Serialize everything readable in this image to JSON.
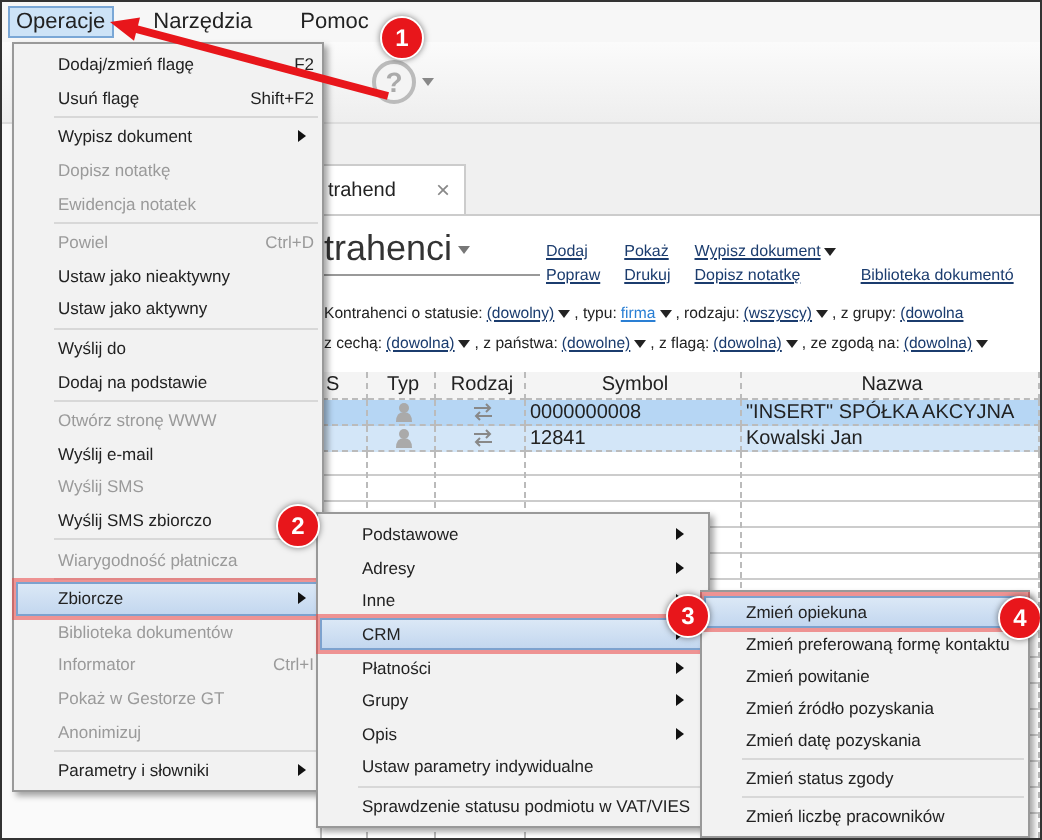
{
  "menubar": [
    {
      "label": "Operacje",
      "selected": true
    },
    {
      "label": "Narzędzia",
      "selected": false
    },
    {
      "label": "Pomoc",
      "selected": false
    }
  ],
  "toolbar": {
    "help_glyph": "?"
  },
  "tab": {
    "label": "trahend",
    "close": "×"
  },
  "heading": "trahenci",
  "link_columns": [
    [
      {
        "text": "Dodaj",
        "dropdown": false
      },
      {
        "text": "Popraw",
        "dropdown": false
      }
    ],
    [
      {
        "text": "Pokaż",
        "dropdown": false
      },
      {
        "text": "Drukuj",
        "dropdown": false
      }
    ],
    [
      {
        "text": "Wypisz dokument",
        "dropdown": true
      },
      {
        "text": "Dopisz notatkę",
        "dropdown": false
      }
    ],
    [
      {
        "text": "Biblioteka dokumentó",
        "dropdown": false
      }
    ]
  ],
  "filters": [
    [
      {
        "kind": "label",
        "text": "Kontrahenci o statusie:"
      },
      {
        "kind": "dropdown",
        "text": "(dowolny)",
        "highlighted": false
      },
      {
        "kind": "label",
        "text": ", typu:"
      },
      {
        "kind": "dropdown",
        "text": "firma",
        "highlighted": true
      },
      {
        "kind": "label",
        "text": ", rodzaju:"
      },
      {
        "kind": "dropdown",
        "text": "(wszyscy)",
        "highlighted": false
      },
      {
        "kind": "label",
        "text": ", z grupy:"
      },
      {
        "kind": "cut",
        "text": "(dowolna"
      }
    ],
    [
      {
        "kind": "label",
        "text": "z cechą:"
      },
      {
        "kind": "dropdown",
        "text": "(dowolna)",
        "highlighted": false
      },
      {
        "kind": "label",
        "text": ", z państwa:"
      },
      {
        "kind": "dropdown",
        "text": "(dowolne)",
        "highlighted": false
      },
      {
        "kind": "label",
        "text": ", z flagą:"
      },
      {
        "kind": "dropdown",
        "text": "(dowolna)",
        "highlighted": false
      },
      {
        "kind": "label",
        "text": ", ze zgodą na:"
      },
      {
        "kind": "dropdown",
        "text": "(dowolna)",
        "highlighted": false
      }
    ]
  ],
  "table": {
    "columns": [
      "S",
      "Typ",
      "Rodzaj",
      "Symbol",
      "Nazwa"
    ],
    "rows": [
      {
        "symbol": "0000000008",
        "name": "\"INSERT\" SPÓŁKA AKCYJNA",
        "selected": true
      },
      {
        "symbol": "12841",
        "name": "Kowalski Jan",
        "selected": false
      }
    ]
  },
  "menu": [
    {
      "kind": "item",
      "label": "Dodaj/zmień flagę",
      "shortcut": "F2",
      "disabled": false,
      "submenu": false,
      "selected": false
    },
    {
      "kind": "item",
      "label": "Usuń flagę",
      "shortcut": "Shift+F2",
      "disabled": false,
      "submenu": false,
      "selected": false
    },
    {
      "kind": "separator"
    },
    {
      "kind": "item",
      "label": "Wypisz dokument",
      "disabled": false,
      "submenu": true,
      "selected": false
    },
    {
      "kind": "item",
      "label": "Dopisz notatkę",
      "disabled": true,
      "submenu": false,
      "selected": false
    },
    {
      "kind": "item",
      "label": "Ewidencja notatek",
      "disabled": true,
      "submenu": false,
      "selected": false
    },
    {
      "kind": "separator"
    },
    {
      "kind": "item",
      "label": "Powiel",
      "shortcut": "Ctrl+D",
      "disabled": true,
      "submenu": false,
      "selected": false
    },
    {
      "kind": "item",
      "label": "Ustaw jako nieaktywny",
      "disabled": false,
      "submenu": false,
      "selected": false
    },
    {
      "kind": "item",
      "label": "Ustaw jako aktywny",
      "disabled": false,
      "submenu": false,
      "selected": false
    },
    {
      "kind": "separator"
    },
    {
      "kind": "item",
      "label": "Wyślij do",
      "disabled": false,
      "submenu": false,
      "selected": false
    },
    {
      "kind": "item",
      "label": "Dodaj na podstawie",
      "disabled": false,
      "submenu": false,
      "selected": false
    },
    {
      "kind": "separator"
    },
    {
      "kind": "item",
      "label": "Otwórz stronę WWW",
      "disabled": true,
      "submenu": false,
      "selected": false
    },
    {
      "kind": "item",
      "label": "Wyślij e-mail",
      "disabled": false,
      "submenu": false,
      "selected": false
    },
    {
      "kind": "item",
      "label": "Wyślij SMS",
      "disabled": true,
      "submenu": false,
      "selected": false
    },
    {
      "kind": "item",
      "label": "Wyślij SMS zbiorczo",
      "disabled": false,
      "submenu": false,
      "selected": false
    },
    {
      "kind": "separator"
    },
    {
      "kind": "item",
      "label": "Wiarygodność płatnicza",
      "disabled": true,
      "submenu": false,
      "selected": false
    },
    {
      "kind": "separator"
    },
    {
      "kind": "item",
      "label": "Zbiorcze",
      "disabled": false,
      "submenu": true,
      "selected": true
    },
    {
      "kind": "item",
      "label": "Biblioteka dokumentów",
      "disabled": true,
      "submenu": false,
      "selected": false
    },
    {
      "kind": "item",
      "label": "Informator",
      "shortcut": "Ctrl+I",
      "disabled": true,
      "submenu": false,
      "selected": false
    },
    {
      "kind": "item",
      "label": "Pokaż w Gestorze GT",
      "disabled": true,
      "submenu": false,
      "selected": false
    },
    {
      "kind": "item",
      "label": "Anonimizuj",
      "disabled": true,
      "submenu": false,
      "selected": false
    },
    {
      "kind": "separator"
    },
    {
      "kind": "item",
      "label": "Parametry i słowniki",
      "disabled": false,
      "submenu": true,
      "selected": false
    }
  ],
  "submenu": [
    {
      "kind": "item",
      "label": "Podstawowe",
      "disabled": false,
      "submenu": true,
      "selected": false
    },
    {
      "kind": "item",
      "label": "Adresy",
      "disabled": false,
      "submenu": true,
      "selected": false
    },
    {
      "kind": "item",
      "label": "Inne",
      "disabled": false,
      "submenu": true,
      "selected": false
    },
    {
      "kind": "item",
      "label": "CRM",
      "disabled": false,
      "submenu": true,
      "selected": true
    },
    {
      "kind": "item",
      "label": "Płatności",
      "disabled": false,
      "submenu": true,
      "selected": false
    },
    {
      "kind": "item",
      "label": "Grupy",
      "disabled": false,
      "submenu": true,
      "selected": false
    },
    {
      "kind": "item",
      "label": "Opis",
      "disabled": false,
      "submenu": true,
      "selected": false
    },
    {
      "kind": "item",
      "label": "Ustaw parametry indywidualne",
      "disabled": false,
      "submenu": false,
      "selected": false
    },
    {
      "kind": "separator"
    },
    {
      "kind": "item",
      "label": "Sprawdzenie statusu podmiotu w VAT/VIES",
      "disabled": false,
      "submenu": false,
      "selected": false
    }
  ],
  "crm_menu": [
    {
      "kind": "item",
      "label": "Zmień opiekuna",
      "disabled": false,
      "submenu": false,
      "selected": true
    },
    {
      "kind": "item",
      "label": "Zmień preferowaną formę kontaktu",
      "disabled": false,
      "submenu": false,
      "selected": false
    },
    {
      "kind": "item",
      "label": "Zmień powitanie",
      "disabled": false,
      "submenu": false,
      "selected": false
    },
    {
      "kind": "item",
      "label": "Zmień źródło pozyskania",
      "disabled": false,
      "submenu": false,
      "selected": false
    },
    {
      "kind": "item",
      "label": "Zmień datę pozyskania",
      "disabled": false,
      "submenu": false,
      "selected": false
    },
    {
      "kind": "separator"
    },
    {
      "kind": "item",
      "label": "Zmień status zgody",
      "disabled": false,
      "submenu": false,
      "selected": false
    },
    {
      "kind": "separator"
    },
    {
      "kind": "item",
      "label": "Zmień liczbę pracowników",
      "disabled": false,
      "submenu": false,
      "selected": false
    }
  ],
  "annotations": [
    {
      "number": "1"
    },
    {
      "number": "2"
    },
    {
      "number": "3"
    },
    {
      "number": "4"
    }
  ]
}
